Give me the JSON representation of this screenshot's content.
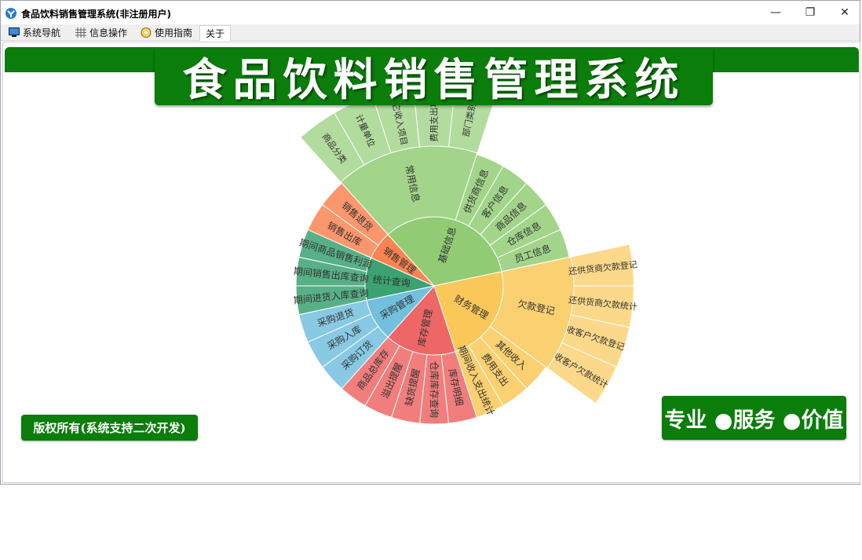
{
  "window": {
    "title": "食品饮料销售管理系统(非注册用户)",
    "minimize_glyph": "—",
    "restore_glyph": "❐",
    "close_glyph": "✕"
  },
  "menu": {
    "tabs": [
      {
        "label": "系统导航",
        "icon": "monitor-icon"
      },
      {
        "label": "信息操作",
        "icon": "grid-icon"
      },
      {
        "label": "使用指南",
        "icon": "guide-icon"
      },
      {
        "label": "关于",
        "icon": ""
      }
    ]
  },
  "banner": {
    "title": "食品饮料销售管理系统"
  },
  "footer": {
    "copyright": "版权所有(系统支持二次开发)",
    "slogan": "专业 ●服务 ●价值"
  },
  "colors": {
    "brand_green": "#0a7d0a"
  },
  "sunburst": {
    "groups": [
      {
        "name": "基础信息",
        "color": "#91cc75",
        "subs": [
          {
            "name": "常用信息",
            "leaves": [
              "商品分类",
              "计量单位",
              "其它收入项目",
              "费用支出项目",
              "部门类别"
            ]
          },
          {
            "name": "供货商信息",
            "leaves": []
          },
          {
            "name": "客户信息",
            "leaves": []
          },
          {
            "name": "商品信息",
            "leaves": []
          },
          {
            "name": "仓库信息",
            "leaves": []
          },
          {
            "name": "员工信息",
            "leaves": []
          }
        ]
      },
      {
        "name": "财务管理",
        "color": "#fac858",
        "subs": [
          {
            "name": "欠款登记",
            "leaves": [
              "还供货商欠款登记",
              "还供货商欠款统计",
              "收客户欠款登记",
              "收客户欠款统计"
            ]
          },
          {
            "name": "其他收入",
            "leaves": []
          },
          {
            "name": "费用支出",
            "leaves": []
          },
          {
            "name": "期间收入支出统计",
            "leaves": []
          }
        ]
      },
      {
        "name": "库存管理",
        "color": "#ee6666",
        "subs": [
          {
            "name": "库存明细",
            "leaves": []
          },
          {
            "name": "仓库库存查询",
            "leaves": []
          },
          {
            "name": "缺货提醒",
            "leaves": []
          },
          {
            "name": "溢出提醒",
            "leaves": []
          },
          {
            "name": "商品总库存",
            "leaves": []
          }
        ]
      },
      {
        "name": "采购管理",
        "color": "#73c0de",
        "subs": [
          {
            "name": "采购订货",
            "leaves": []
          },
          {
            "name": "采购入库",
            "leaves": []
          },
          {
            "name": "采购退货",
            "leaves": []
          }
        ]
      },
      {
        "name": "统计查询",
        "color": "#3ba272",
        "subs": [
          {
            "name": "期间进货入库查询",
            "leaves": []
          },
          {
            "name": "期间销售出库查询",
            "leaves": []
          },
          {
            "name": "期间商品销售利润",
            "leaves": []
          }
        ]
      },
      {
        "name": "销售管理",
        "color": "#fc8452",
        "subs": [
          {
            "name": "销售出库",
            "leaves": []
          },
          {
            "name": "销售退货",
            "leaves": []
          }
        ]
      }
    ]
  }
}
